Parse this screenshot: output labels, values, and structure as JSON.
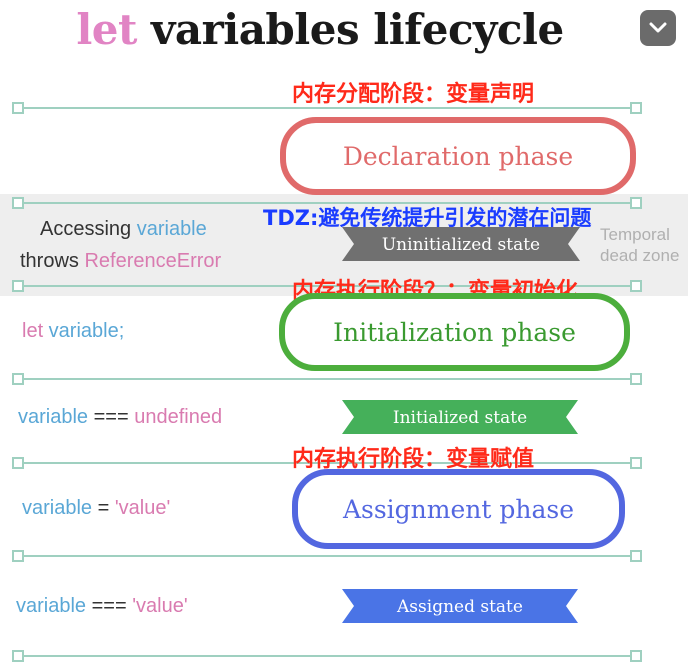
{
  "title": {
    "part1": "let",
    "part2": " variables lifecycle",
    "color1": "#e184c4",
    "color2": "#1a1a1a"
  },
  "menu": {
    "icon": "chevron-down-icon",
    "glyph": "⌄"
  },
  "annotations": {
    "declaration_note": "内存分配阶段：变量声明",
    "tdz_note": "TDZ:避免传统提升引发的潜在问题",
    "initialization_note": "内存执行阶段？：变量初始化",
    "assignment_note": "内存执行阶段：变量赋值",
    "red": "#ff2a1a",
    "blue": "#1a3cff"
  },
  "phases": {
    "declaration": {
      "label": "Declaration phase",
      "color": "#e06a6a"
    },
    "initialization": {
      "label": "Initialization phase",
      "color": "#4cae3c"
    },
    "assignment": {
      "label": "Assignment phase",
      "color": "#5367e0"
    }
  },
  "states": {
    "uninitialized": {
      "label": "Uninitialized state",
      "color": "#707070"
    },
    "initialized": {
      "label": "Initialized state",
      "color": "#45b05a"
    },
    "assigned": {
      "label": "Assigned state",
      "color": "#4a74e6"
    }
  },
  "tdz_zone": {
    "line1": "Temporal",
    "line2": "dead zone"
  },
  "code": {
    "accessing": {
      "w1": "Accessing",
      "w2": " variable"
    },
    "throws": {
      "w1": "throws",
      "w2": " ReferenceError"
    },
    "let_decl": {
      "w1": "let",
      "w2": " variable",
      "w3": ";"
    },
    "eq_undefined": {
      "w1": "variable",
      "w2": " === ",
      "w3": "undefined"
    },
    "assign": {
      "w1": "variable",
      "w2": " = ",
      "w3": "'value'"
    },
    "eq_value": {
      "w1": "variable",
      "w2": " === ",
      "w3": "'value'"
    }
  }
}
